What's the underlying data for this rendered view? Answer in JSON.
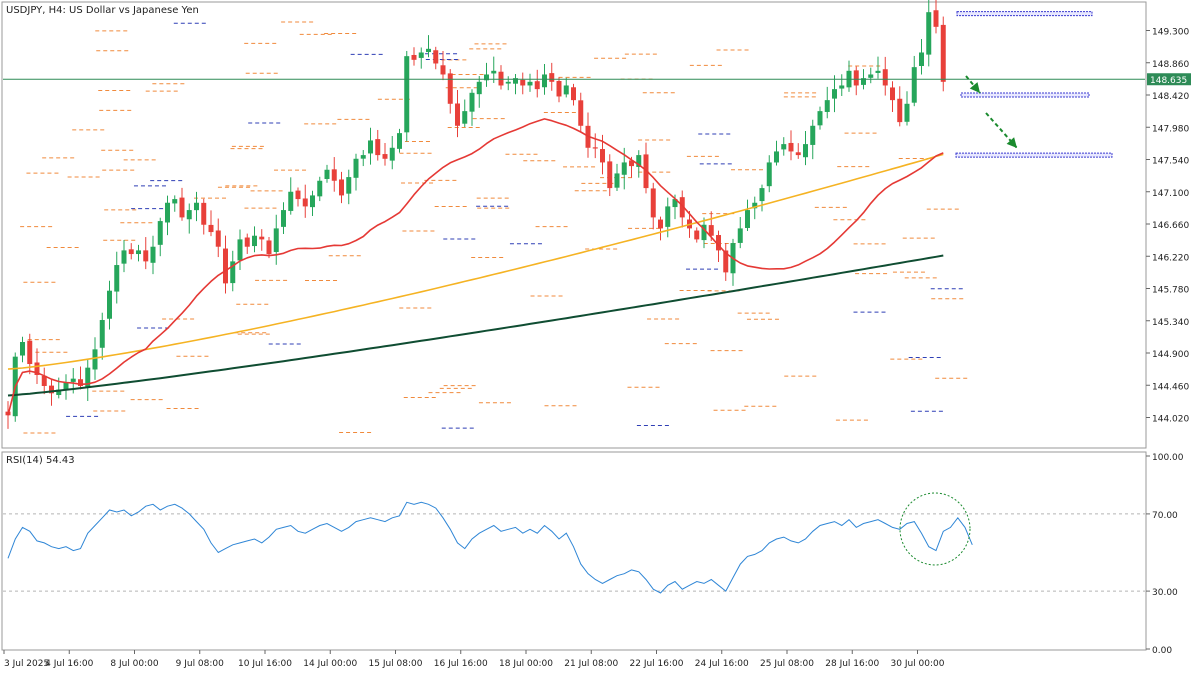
{
  "header": {
    "title": "USDJPY, H4:  US Dollar vs Japanese Yen"
  },
  "rsi_label": "RSI(14) 54.43",
  "colors": {
    "bull": "#26a65b",
    "bear": "#e8403a",
    "ma_fast": "#e53935",
    "ma_mid": "#f5b323",
    "ma_slow": "#0f4d32",
    "rsi_line": "#2f86d6",
    "current_price": "#2e8b57",
    "arrow": "#1a8a2e",
    "zone": "#3a3acf"
  },
  "chart_data": [
    {
      "type": "candlestick",
      "symbol": "USDJPY",
      "timeframe": "H4",
      "ylim": [
        143.78,
        150.25
      ],
      "y_ticks": [
        "149.300",
        "148.860",
        "148.420",
        "147.980",
        "147.540",
        "147.100",
        "146.660",
        "146.220",
        "145.780",
        "145.340",
        "144.900",
        "144.460",
        "144.020"
      ],
      "x_ticks": [
        "3 Jul 2025",
        "4 Jul 16:00",
        "8 Jul 00:00",
        "9 Jul 08:00",
        "10 Jul 16:00",
        "14 Jul 00:00",
        "15 Jul 08:00",
        "16 Jul 16:00",
        "18 Jul 00:00",
        "21 Jul 08:00",
        "22 Jul 16:00",
        "24 Jul 16:00",
        "25 Jul 08:00",
        "28 Jul 16:00",
        "30 Jul 00:00"
      ],
      "current_price": "148.635",
      "closes": [
        144.05,
        144.85,
        145.05,
        144.75,
        144.6,
        144.45,
        144.35,
        144.4,
        144.5,
        144.55,
        144.45,
        144.7,
        144.95,
        145.35,
        145.75,
        146.1,
        146.3,
        146.25,
        146.3,
        146.15,
        146.35,
        146.7,
        146.95,
        147.0,
        146.75,
        146.85,
        146.95,
        146.65,
        146.55,
        146.35,
        145.85,
        146.15,
        146.45,
        146.35,
        146.5,
        146.45,
        146.25,
        146.6,
        146.85,
        147.1,
        147.0,
        146.9,
        147.05,
        147.25,
        147.4,
        147.25,
        147.05,
        147.3,
        147.55,
        147.6,
        147.8,
        147.6,
        147.55,
        147.7,
        147.9,
        148.95,
        148.9,
        149.0,
        149.05,
        148.85,
        148.7,
        148.3,
        148.0,
        148.2,
        148.45,
        148.6,
        148.7,
        148.75,
        148.55,
        148.6,
        148.65,
        148.55,
        148.6,
        148.5,
        148.7,
        148.6,
        148.4,
        148.55,
        148.35,
        148.0,
        147.7,
        147.7,
        147.5,
        147.15,
        147.35,
        147.5,
        147.45,
        147.6,
        147.15,
        146.75,
        146.6,
        146.9,
        147.0,
        146.75,
        146.6,
        146.45,
        146.65,
        146.5,
        146.3,
        146.0,
        146.4,
        146.6,
        146.85,
        146.95,
        147.15,
        147.5,
        147.65,
        147.75,
        147.65,
        147.6,
        147.75,
        148.0,
        148.2,
        148.35,
        148.5,
        148.55,
        148.75,
        148.55,
        148.65,
        148.7,
        148.75,
        148.55,
        148.35,
        148.05,
        148.3,
        148.8,
        149.0,
        149.55,
        149.35,
        148.6
      ],
      "ma_fast_end": 147.63,
      "ma_mid_end": 147.61,
      "ma_slow_end": 146.23
    },
    {
      "type": "line",
      "name": "RSI(14)",
      "ylim": [
        0,
        100
      ],
      "y_ticks": [
        "100.00",
        "70.00",
        "30.00",
        "0.00"
      ],
      "levels": [
        70,
        30
      ],
      "values": [
        47,
        57,
        63,
        61,
        56,
        55,
        53,
        52,
        53,
        51,
        52,
        60,
        64,
        68,
        72,
        71,
        72,
        69,
        71,
        74,
        75,
        72,
        74,
        75,
        73,
        70,
        66,
        62,
        55,
        50,
        52,
        54,
        55,
        56,
        57,
        55,
        58,
        62,
        63,
        64,
        61,
        60,
        62,
        64,
        65,
        63,
        61,
        63,
        66,
        67,
        68,
        67,
        66,
        68,
        69,
        76,
        75,
        76,
        75,
        73,
        68,
        62,
        55,
        52,
        57,
        60,
        62,
        64,
        61,
        62,
        63,
        60,
        62,
        60,
        64,
        61,
        57,
        60,
        53,
        44,
        39,
        36,
        34,
        36,
        38,
        39,
        41,
        40,
        36,
        31,
        29,
        33,
        35,
        31,
        33,
        35,
        34,
        36,
        33,
        30,
        37,
        44,
        48,
        49,
        51,
        55,
        57,
        58,
        56,
        55,
        57,
        61,
        64,
        65,
        66,
        64,
        67,
        63,
        65,
        66,
        67,
        65,
        63,
        62,
        65,
        66,
        60,
        53,
        51,
        61,
        63,
        68,
        63,
        54
      ]
    }
  ]
}
